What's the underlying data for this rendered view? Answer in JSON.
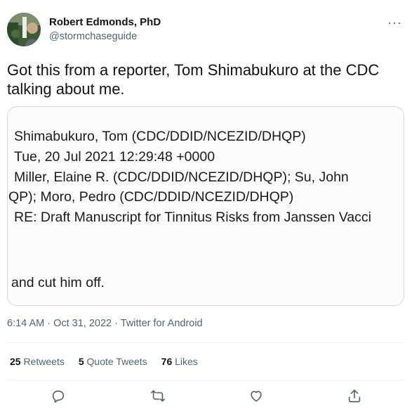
{
  "author": {
    "name": "Robert Edmonds, PhD",
    "handle": "@stormchaseguide"
  },
  "menu": {
    "more_label": "···"
  },
  "tweet": {
    "text": "Got this from a reporter, Tom Shimabukuro at the CDC talking about me."
  },
  "media": {
    "lines": [
      "Shimabukuro, Tom (CDC/DDID/NCEZID/DHQP)",
      "Tue, 20 Jul 2021 12:29:48 +0000",
      "Miller, Elaine R. (CDC/DDID/NCEZID/DHQP); Su, John",
      "QP); Moro, Pedro (CDC/DDID/NCEZID/DHQP)",
      "RE: Draft Manuscript for Tinnitus Risks from Janssen Vacci",
      "and cut him off."
    ]
  },
  "meta": {
    "time": "6:14 AM",
    "date": "Oct 31, 2022",
    "source": "Twitter for Android"
  },
  "stats": {
    "retweets": "25",
    "retweets_label": "Retweets",
    "quote_tweets": "5",
    "quote_tweets_label": "Quote Tweets",
    "likes": "76",
    "likes_label": "Likes"
  },
  "actions": [
    "reply-icon",
    "retweet-icon",
    "like-icon",
    "share-icon"
  ]
}
